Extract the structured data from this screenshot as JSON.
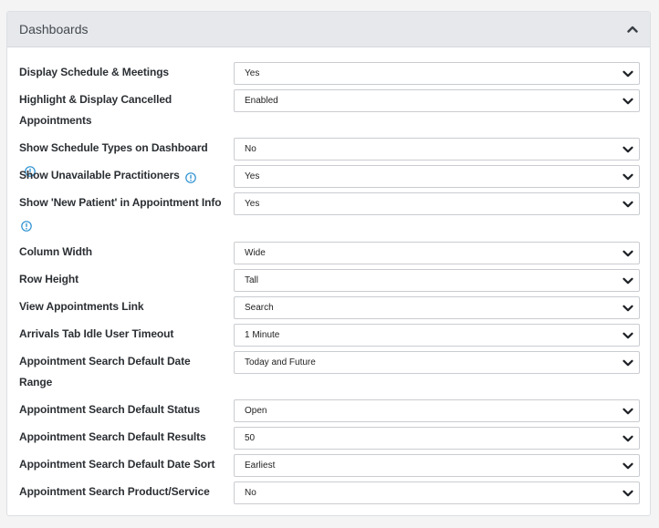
{
  "panel": {
    "title": "Dashboards",
    "collapse_icon": "chevron-up-icon"
  },
  "settings": [
    {
      "label": "Display Schedule & Meetings",
      "value": "Yes",
      "info": false
    },
    {
      "label": "Highlight & Display Cancelled Appointments",
      "value": "Enabled",
      "info": false
    },
    {
      "label": "Show Schedule Types on Dashboard",
      "value": "No",
      "info": true
    },
    {
      "label": "Show Unavailable Practitioners",
      "value": "Yes",
      "info": true
    },
    {
      "label": "Show 'New Patient' in Appointment Info",
      "value": "Yes",
      "info": true
    },
    {
      "label": "Column Width",
      "value": "Wide",
      "info": false
    },
    {
      "label": "Row Height",
      "value": "Tall",
      "info": false
    },
    {
      "label": "View Appointments Link",
      "value": "Search",
      "info": false
    },
    {
      "label": "Arrivals Tab Idle User Timeout",
      "value": "1 Minute",
      "info": false
    },
    {
      "label": "Appointment Search Default Date Range",
      "value": "Today and Future",
      "info": false
    },
    {
      "label": "Appointment Search Default Status",
      "value": "Open",
      "info": false
    },
    {
      "label": "Appointment Search Default Results",
      "value": "50",
      "info": false
    },
    {
      "label": "Appointment Search Default Date Sort",
      "value": "Earliest",
      "info": false
    },
    {
      "label": "Appointment Search Product/Service",
      "value": "No",
      "info": false
    }
  ],
  "colors": {
    "info_icon": "#2a8fd0",
    "header_bg": "#e6e8eb"
  }
}
